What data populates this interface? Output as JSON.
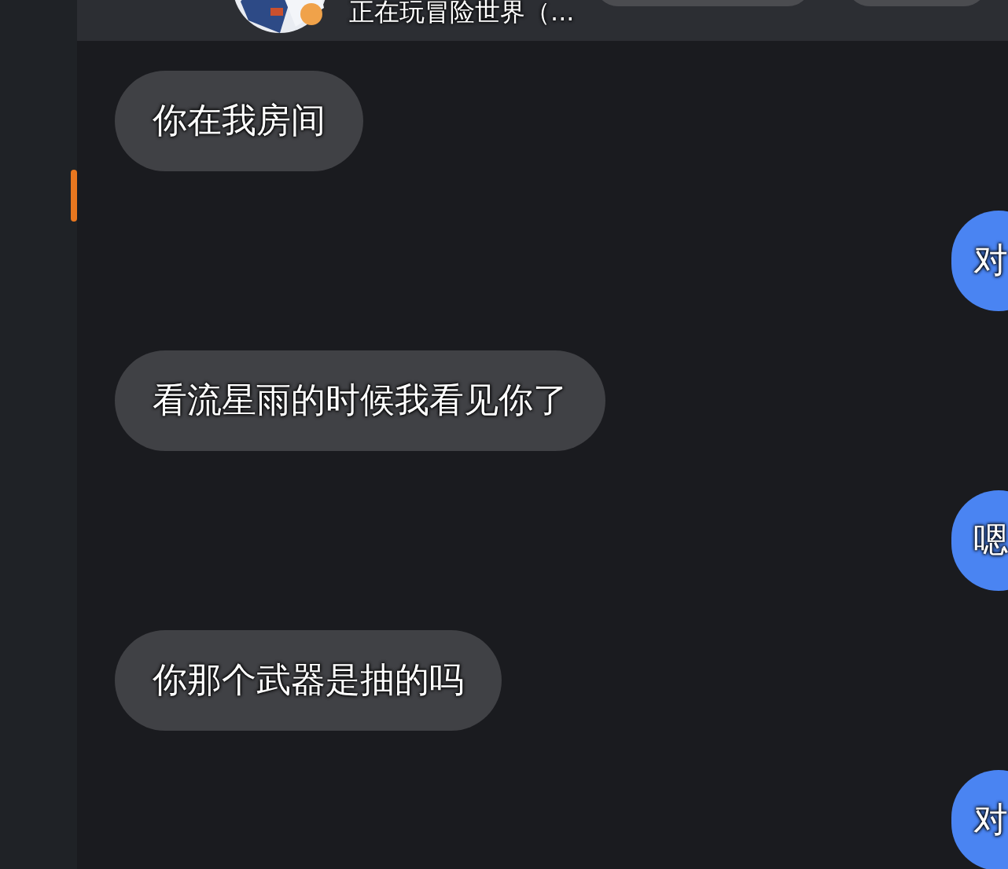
{
  "sidebar": {
    "items": [
      {
        "selected": true
      }
    ]
  },
  "header": {
    "status": "正在玩冒险世界（...",
    "buttons": [
      {
        "kind": "pill"
      },
      {
        "kind": "pill"
      }
    ]
  },
  "messages": [
    {
      "kind": "received",
      "text": "你在我房间"
    },
    {
      "kind": "sent",
      "text": "对"
    },
    {
      "kind": "received",
      "text": "看流星雨的时候我看见你了"
    },
    {
      "kind": "sent",
      "text": "嗯"
    },
    {
      "kind": "received",
      "text": "你那个武器是抽的吗"
    },
    {
      "kind": "sent",
      "text": "对"
    }
  ]
}
